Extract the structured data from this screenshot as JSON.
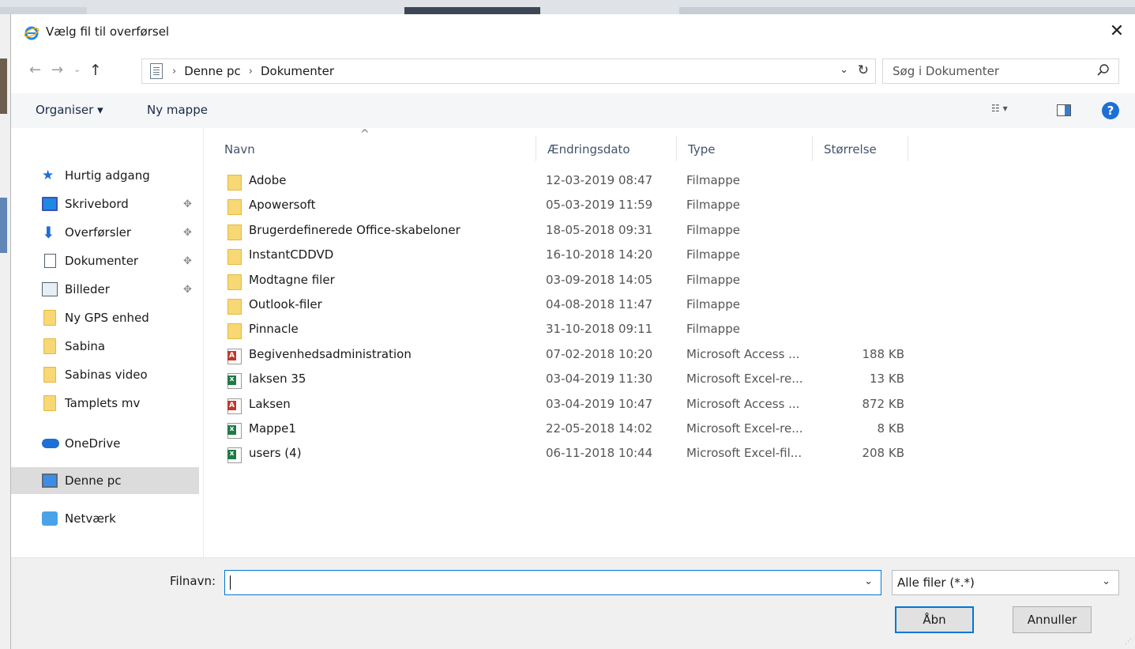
{
  "window": {
    "title": "Vælg fil til overførsel",
    "close_glyph": "✕"
  },
  "navigation": {
    "back_glyph": "←",
    "forward_glyph": "→",
    "recent_glyph": "⌄",
    "up_glyph": "↑",
    "breadcrumbs": [
      "Denne pc",
      "Dokumenter"
    ],
    "crumb_sep": "›",
    "dropdown_glyph": "⌄",
    "refresh_glyph": "↻",
    "search_placeholder": "Søg i Dokumenter"
  },
  "toolbar": {
    "organise_label": "Organiser ▾",
    "new_folder_label": "Ny mappe",
    "view_glyph": "☷ ▾",
    "help_glyph": "?"
  },
  "navpane": {
    "pin_glyph": "📌",
    "items": [
      {
        "label": "Hurtig adgang",
        "icon": "star-icon"
      },
      {
        "label": "Skrivebord",
        "icon": "desktop-icon",
        "pinned": true
      },
      {
        "label": "Overførsler",
        "icon": "download-icon",
        "pinned": true
      },
      {
        "label": "Dokumenter",
        "icon": "document-icon",
        "pinned": true
      },
      {
        "label": "Billeder",
        "icon": "pictures-icon",
        "pinned": true
      },
      {
        "label": "Ny GPS enhed",
        "icon": "folder-icon"
      },
      {
        "label": "Sabina",
        "icon": "folder-icon"
      },
      {
        "label": "Sabinas video",
        "icon": "folder-icon"
      },
      {
        "label": "Tamplets mv",
        "icon": "folder-icon"
      },
      {
        "label": "OneDrive",
        "icon": "onedrive-icon"
      },
      {
        "label": "Denne pc",
        "icon": "pc-icon",
        "selected": true
      },
      {
        "label": "Netværk",
        "icon": "network-icon"
      }
    ]
  },
  "columns": {
    "sort_glyph": "^",
    "name": "Navn",
    "date": "Ændringsdato",
    "type": "Type",
    "size": "Størrelse"
  },
  "files": [
    {
      "name": "Adobe",
      "date": "12-03-2019 08:47",
      "type": "Filmappe",
      "size": "",
      "icon": "folder"
    },
    {
      "name": "Apowersoft",
      "date": "05-03-2019 11:59",
      "type": "Filmappe",
      "size": "",
      "icon": "folder"
    },
    {
      "name": "Brugerdefinerede Office-skabeloner",
      "date": "18-05-2018 09:31",
      "type": "Filmappe",
      "size": "",
      "icon": "folder"
    },
    {
      "name": "InstantCDDVD",
      "date": "16-10-2018 14:20",
      "type": "Filmappe",
      "size": "",
      "icon": "folder"
    },
    {
      "name": "Modtagne filer",
      "date": "03-09-2018 14:05",
      "type": "Filmappe",
      "size": "",
      "icon": "folder"
    },
    {
      "name": "Outlook-filer",
      "date": "04-08-2018 11:47",
      "type": "Filmappe",
      "size": "",
      "icon": "folder"
    },
    {
      "name": "Pinnacle",
      "date": "31-10-2018 09:11",
      "type": "Filmappe",
      "size": "",
      "icon": "folder"
    },
    {
      "name": "Begivenhedsadministration",
      "date": "07-02-2018 10:20",
      "type": "Microsoft Access ...",
      "size": "188 KB",
      "icon": "access"
    },
    {
      "name": "laksen 35",
      "date": "03-04-2019 11:30",
      "type": "Microsoft Excel-re...",
      "size": "13 KB",
      "icon": "excel"
    },
    {
      "name": "Laksen",
      "date": "03-04-2019 10:47",
      "type": "Microsoft Access ...",
      "size": "872 KB",
      "icon": "access"
    },
    {
      "name": "Mappe1",
      "date": "22-05-2018 14:02",
      "type": "Microsoft Excel-re...",
      "size": "8 KB",
      "icon": "excel"
    },
    {
      "name": "users (4)",
      "date": "06-11-2018 10:44",
      "type": "Microsoft Excel-fil...",
      "size": "208 KB",
      "icon": "excel"
    }
  ],
  "bottom": {
    "filename_label": "Filnavn:",
    "filename_value": "",
    "dropdown_glyph": "⌄",
    "filetype_value": "Alle filer (*.*)",
    "open_label": "Åbn",
    "cancel_label": "Annuller"
  }
}
